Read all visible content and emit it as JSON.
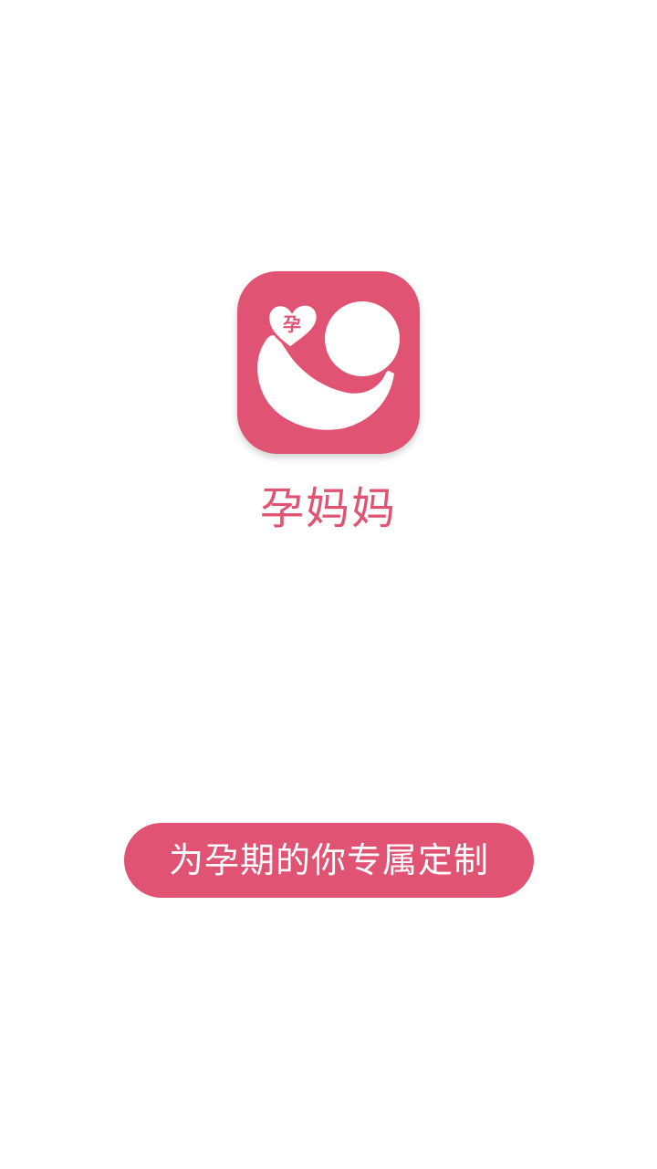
{
  "app": {
    "name": "孕妈妈",
    "logo_badge_text": "孕",
    "slogan": "为孕期的你专属定制"
  },
  "colors": {
    "brand": "#e05372",
    "background": "#ffffff",
    "logo_foreground": "#ffffff"
  },
  "icons": {
    "logo": "pregnant-mother-heart-icon"
  }
}
